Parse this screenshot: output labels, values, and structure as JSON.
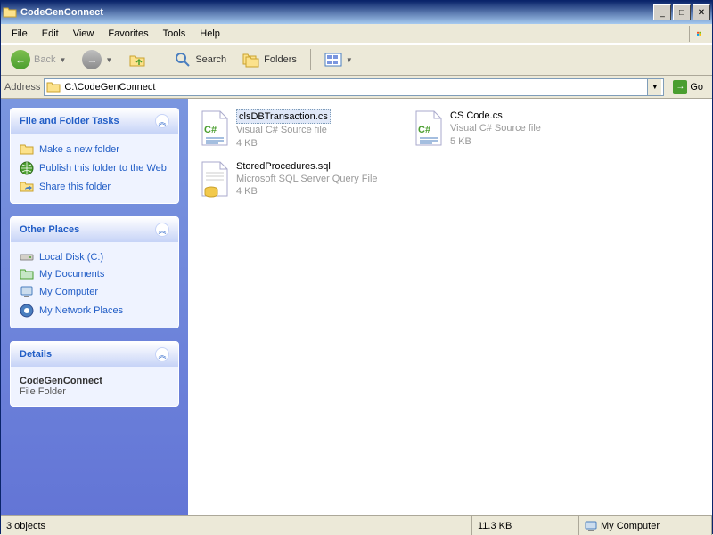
{
  "window": {
    "title": "CodeGenConnect"
  },
  "menu": {
    "file": "File",
    "edit": "Edit",
    "view": "View",
    "favorites": "Favorites",
    "tools": "Tools",
    "help": "Help"
  },
  "toolbar": {
    "back": "Back",
    "search": "Search",
    "folders": "Folders"
  },
  "address": {
    "label": "Address",
    "value": "C:\\CodeGenConnect",
    "go": "Go"
  },
  "sidebar": {
    "tasks": {
      "title": "File and Folder Tasks",
      "items": [
        {
          "label": "Make a new folder",
          "icon": "folder-new"
        },
        {
          "label": "Publish this folder to the Web",
          "icon": "globe"
        },
        {
          "label": "Share this folder",
          "icon": "share"
        }
      ]
    },
    "other": {
      "title": "Other Places",
      "items": [
        {
          "label": "Local Disk (C:)",
          "icon": "drive"
        },
        {
          "label": "My Documents",
          "icon": "docs"
        },
        {
          "label": "My Computer",
          "icon": "computer"
        },
        {
          "label": "My Network Places",
          "icon": "network"
        }
      ]
    },
    "details": {
      "title": "Details",
      "name": "CodeGenConnect",
      "type": "File Folder"
    }
  },
  "files": [
    {
      "name": "clsDBTransaction.cs",
      "type": "Visual C# Source file",
      "size": "4 KB",
      "icon": "cs",
      "selected": true
    },
    {
      "name": "CS Code.cs",
      "type": "Visual C# Source file",
      "size": "5 KB",
      "icon": "cs",
      "selected": false
    },
    {
      "name": "StoredProcedures.sql",
      "type": "Microsoft SQL Server Query File",
      "size": "4 KB",
      "icon": "sql",
      "selected": false
    }
  ],
  "status": {
    "count": "3 objects",
    "size": "11.3 KB",
    "location": "My Computer"
  }
}
